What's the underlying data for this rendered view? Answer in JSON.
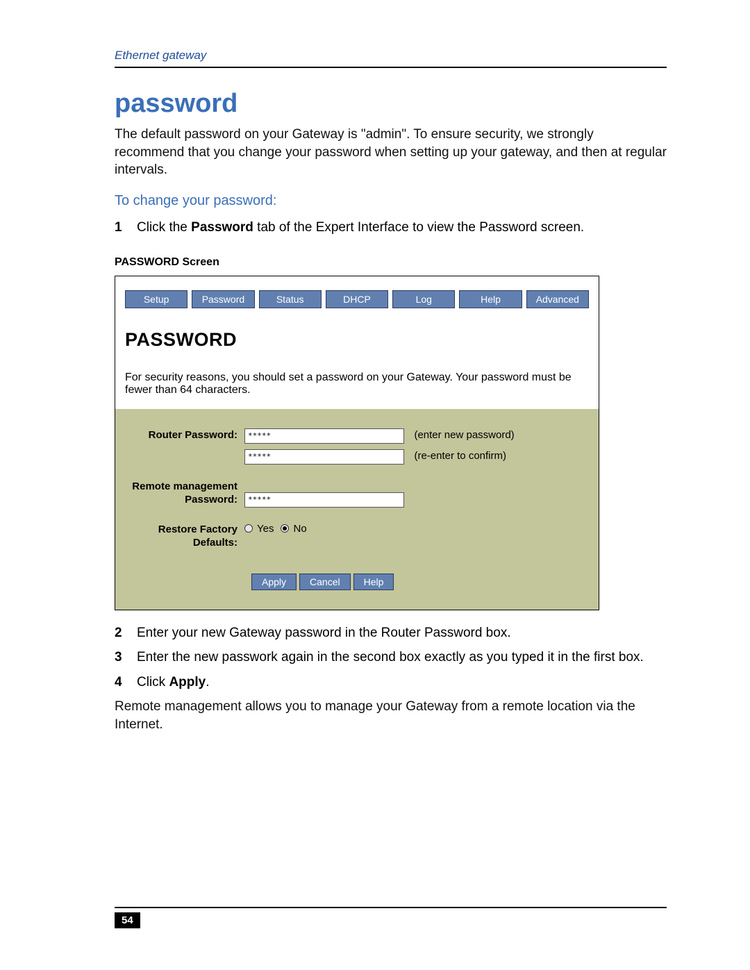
{
  "header": {
    "running": "Ethernet gateway"
  },
  "title": "password",
  "intro": "The default password on your Gateway is \"admin\". To ensure security, we strongly recommend that you change your password when setting up your gateway, and then at regular intervals.",
  "subhead": "To change your password:",
  "steps": {
    "s1_pre": "Click the ",
    "s1_bold": "Password",
    "s1_post": " tab of the Expert Interface to view the Password screen.",
    "s2": "Enter your new Gateway password in the Router Password box.",
    "s3": "Enter the new passwork again in the second box exactly as you typed it in the first box.",
    "s4_pre": "Click ",
    "s4_bold": "Apply",
    "s4_post": "."
  },
  "caption": "PASSWORD Screen",
  "tabs": [
    "Setup",
    "Password",
    "Status",
    "DHCP",
    "Log",
    "Help",
    "Advanced"
  ],
  "screen": {
    "heading": "PASSWORD",
    "desc": "For security reasons, you should set a password on your Gateway. Your password must be fewer than 64 characters.",
    "labels": {
      "router_pw": "Router Password:",
      "remote_pw": "Remote management Password:",
      "restore": "Restore Factory Defaults:"
    },
    "hints": {
      "enter": "(enter new password)",
      "confirm": "(re-enter to confirm)"
    },
    "values": {
      "pw1": "*****",
      "pw2": "*****",
      "remote": "*****"
    },
    "radios": {
      "yes": "Yes",
      "no": "No"
    },
    "buttons": {
      "apply": "Apply",
      "cancel": "Cancel",
      "help": "Help"
    }
  },
  "outro": "Remote management allows you to manage your Gateway from a remote location via the Internet.",
  "page_number": "54"
}
